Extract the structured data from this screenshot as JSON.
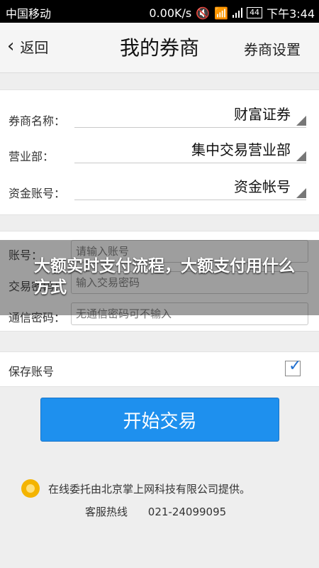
{
  "status_bar": {
    "carrier": "中国移动",
    "speed": "0.00K/s",
    "battery": "44",
    "time": "下午3:44"
  },
  "nav": {
    "back_label": "返回",
    "title": "我的券商",
    "settings_label": "券商设置"
  },
  "broker_form": {
    "rows": [
      {
        "label": "券商名称：",
        "value": "财富证券"
      },
      {
        "label": "营业部：",
        "value": "集中交易营业部"
      },
      {
        "label": "资金账号：",
        "value": "资金帐号"
      }
    ]
  },
  "login_form": {
    "account_label": "账号：",
    "account_placeholder": "请输入账号",
    "password_label": "交易密码：",
    "password_placeholder": "输入交易密码",
    "comm_label": "通信密码：",
    "comm_placeholder": "无通信密码可不输入"
  },
  "save_account": {
    "label": "保存账号",
    "checked": true
  },
  "start_button": "开始交易",
  "footer": {
    "provider": "在线委托由北京掌上网科技有限公司提供。",
    "hotline_label": "客服热线",
    "hotline_number": "021-24099095"
  },
  "overlay_title": "大额实时支付流程，大额支付用什么方式",
  "colors": {
    "primary": "#1e90ee",
    "checkbox_mark": "#1f6fd0",
    "logo": "#f4b400"
  }
}
